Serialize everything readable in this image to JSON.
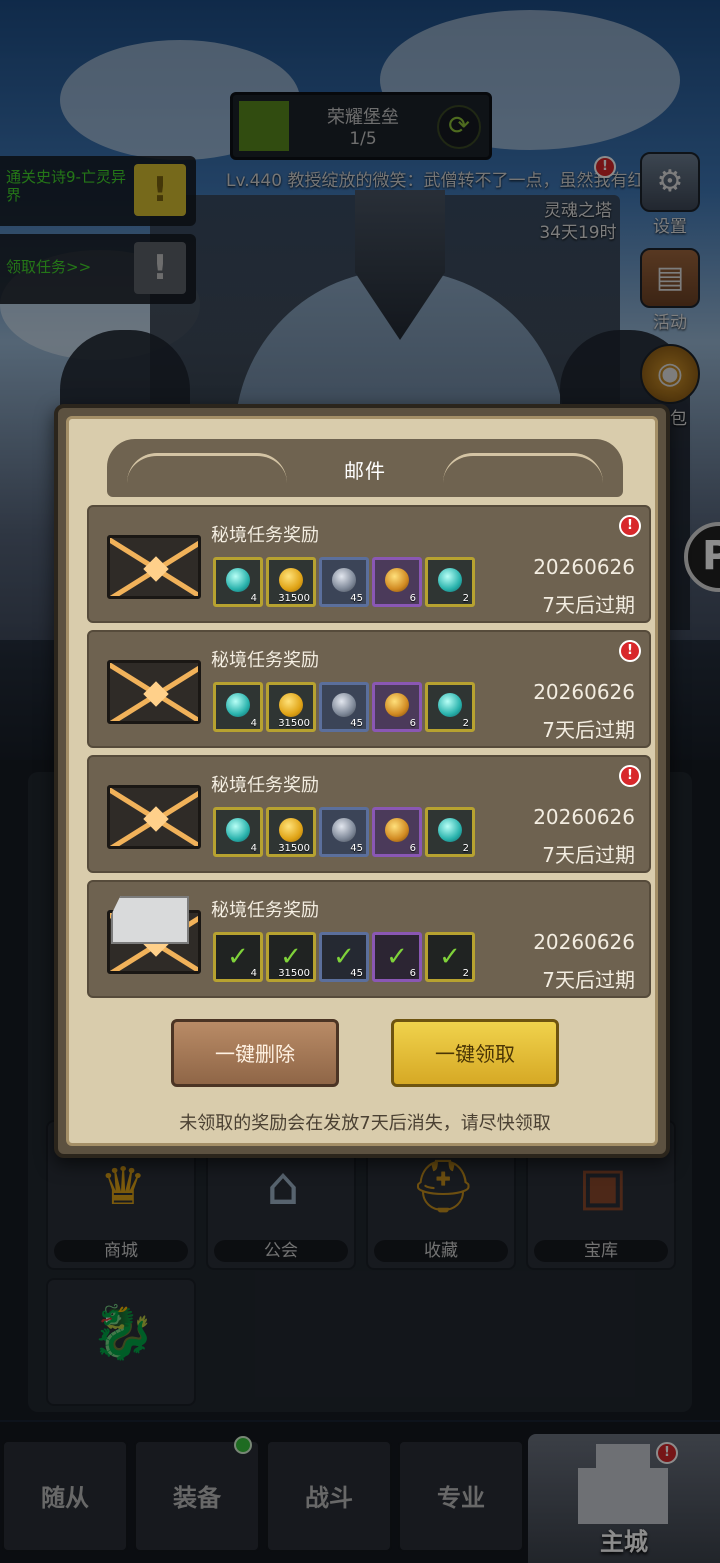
{
  "hud": {
    "stage_title": "荣耀堡垒",
    "stage_progress": "1/5",
    "ticker": "Lv.440 教授绽放的微笑：武僧转不了一点，虽然我有红",
    "quests": [
      {
        "text": "通关史诗9-亡灵异界"
      },
      {
        "text": "领取任务>>"
      }
    ],
    "tower_name": "灵魂之塔",
    "tower_time": "34天19时",
    "side_settings": "设置",
    "side_activity": "活动",
    "side_bag": "背包"
  },
  "mail": {
    "title": "邮件",
    "rows": [
      {
        "subject": "秘境任务奖励",
        "date": "20260626",
        "expiry": "7天后过期",
        "claimed": false,
        "items": [
          {
            "icon": "cyan-gem-icon",
            "qty": "4",
            "quality": "yellow"
          },
          {
            "icon": "gold-coin-icon",
            "qty": "31500",
            "quality": "yellow"
          },
          {
            "icon": "helmet-icon",
            "qty": "45",
            "quality": "blue"
          },
          {
            "icon": "feather-icon",
            "qty": "6",
            "quality": "purple"
          },
          {
            "icon": "cyan-gem-icon",
            "qty": "2",
            "quality": "yellow"
          }
        ]
      },
      {
        "subject": "秘境任务奖励",
        "date": "20260626",
        "expiry": "7天后过期",
        "claimed": false,
        "items": [
          {
            "icon": "cyan-gem-icon",
            "qty": "4",
            "quality": "yellow"
          },
          {
            "icon": "gold-coin-icon",
            "qty": "31500",
            "quality": "yellow"
          },
          {
            "icon": "helmet-icon",
            "qty": "45",
            "quality": "blue"
          },
          {
            "icon": "feather-icon",
            "qty": "6",
            "quality": "purple"
          },
          {
            "icon": "cyan-gem-icon",
            "qty": "2",
            "quality": "yellow"
          }
        ]
      },
      {
        "subject": "秘境任务奖励",
        "date": "20260626",
        "expiry": "7天后过期",
        "claimed": false,
        "items": [
          {
            "icon": "cyan-gem-icon",
            "qty": "4",
            "quality": "yellow"
          },
          {
            "icon": "gold-coin-icon",
            "qty": "31500",
            "quality": "yellow"
          },
          {
            "icon": "helmet-icon",
            "qty": "45",
            "quality": "blue"
          },
          {
            "icon": "feather-icon",
            "qty": "6",
            "quality": "purple"
          },
          {
            "icon": "cyan-gem-icon",
            "qty": "2",
            "quality": "yellow"
          }
        ]
      },
      {
        "subject": "秘境任务奖励",
        "date": "20260626",
        "expiry": "7天后过期",
        "claimed": true,
        "items": [
          {
            "icon": "check-icon",
            "qty": "4",
            "quality": "yellow"
          },
          {
            "icon": "check-icon",
            "qty": "31500",
            "quality": "yellow"
          },
          {
            "icon": "check-icon",
            "qty": "45",
            "quality": "blue"
          },
          {
            "icon": "check-icon",
            "qty": "6",
            "quality": "purple"
          },
          {
            "icon": "check-icon",
            "qty": "2",
            "quality": "yellow"
          }
        ]
      }
    ],
    "delete_all": "一键删除",
    "claim_all": "一键领取",
    "notice": "未领取的奖励会在发放7天后消失，请尽快领取"
  },
  "buildings": [
    "商城",
    "公会",
    "收藏",
    "宝库"
  ],
  "nav": {
    "tabs": [
      "随从",
      "装备",
      "战斗",
      "专业"
    ],
    "home": "主城"
  },
  "colors": {
    "dialog_bg": "#d9ccac",
    "row_bg": "#6e6250",
    "claim_button": "#f0d24c",
    "delete_button": "#b98b66",
    "quest_green": "#43d82b",
    "alert_red": "#d8272b"
  }
}
